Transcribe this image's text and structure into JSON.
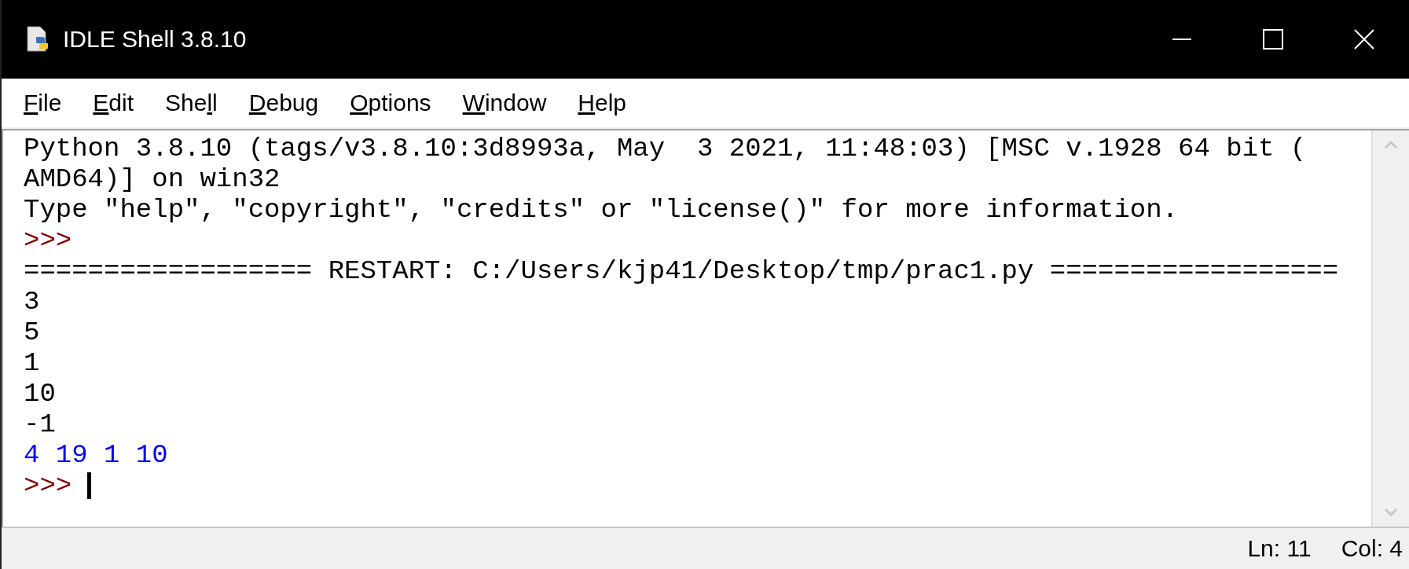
{
  "window": {
    "title": "IDLE Shell 3.8.10"
  },
  "menu": [
    {
      "key": "F",
      "post": "ile"
    },
    {
      "key": "E",
      "post": "dit"
    },
    {
      "pre": "She",
      "key": "l",
      "post": "l"
    },
    {
      "key": "D",
      "post": "ebug"
    },
    {
      "key": "O",
      "post": "ptions"
    },
    {
      "key": "W",
      "post": "indow"
    },
    {
      "key": "H",
      "post": "elp"
    }
  ],
  "shell": {
    "lines": [
      {
        "kind": "output",
        "text": "Python 3.8.10 (tags/v3.8.10:3d8993a, May  3 2021, 11:48:03) [MSC v.1928 64 bit (",
        "cursor": false
      },
      {
        "kind": "output",
        "text": "AMD64)] on win32",
        "cursor": false
      },
      {
        "kind": "output",
        "text": "Type \"help\", \"copyright\", \"credits\" or \"license()\" for more information.",
        "cursor": false
      },
      {
        "kind": "prompt",
        "text": ">>>",
        "cursor": false
      },
      {
        "kind": "output",
        "text": "================== RESTART: C:/Users/kjp41/Desktop/tmp/prac1.py ==================",
        "cursor": false
      },
      {
        "kind": "output",
        "text": "3",
        "cursor": false
      },
      {
        "kind": "output",
        "text": "5",
        "cursor": false
      },
      {
        "kind": "output",
        "text": "1",
        "cursor": false
      },
      {
        "kind": "output",
        "text": "10",
        "cursor": false
      },
      {
        "kind": "output",
        "text": "-1",
        "cursor": false
      },
      {
        "kind": "stdin",
        "text": "4 19 1 10",
        "cursor": false
      },
      {
        "kind": "prompt",
        "text": ">>>",
        "cursor": true
      }
    ]
  },
  "status_bar": {
    "line": "Ln: 11",
    "column": "Col: 4"
  }
}
